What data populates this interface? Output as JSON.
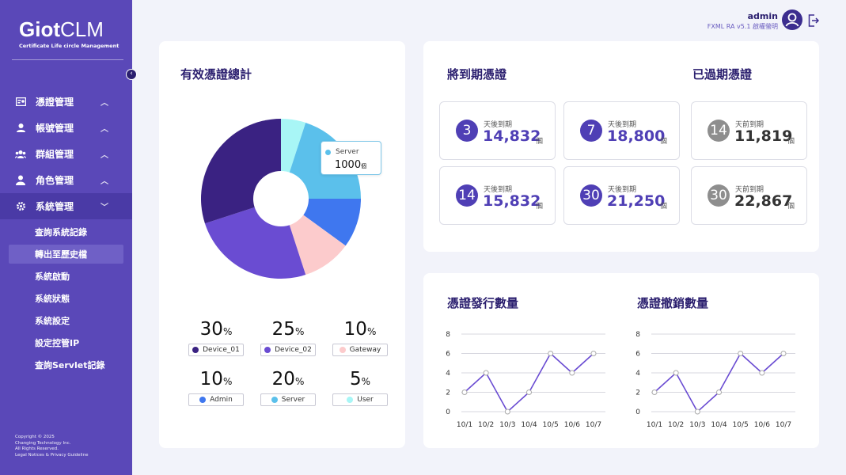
{
  "sidebar": {
    "logo_main": "Giot",
    "logo_clm": "CLM",
    "logo_sub": "Certificate Life circle Management",
    "menu": [
      {
        "label": "憑證管理",
        "icon": "certificate-icon",
        "caret": "^"
      },
      {
        "label": "帳號管理",
        "icon": "account-icon",
        "caret": "^"
      },
      {
        "label": "群組管理",
        "icon": "group-icon",
        "caret": "^"
      },
      {
        "label": "角色管理",
        "icon": "role-icon",
        "caret": "^"
      },
      {
        "label": "系統管理",
        "icon": "gear-icon",
        "caret": "v"
      }
    ],
    "submenu": [
      "查詢系統記錄",
      "轉出至歷史檔",
      "系統啟動",
      "系統狀態",
      "系統設定",
      "設定控管IP",
      "查詢Servlet記錄"
    ],
    "copyright": [
      "Copyright © 2025",
      "Changing Technology Inc.",
      "All Rights Reserved.",
      "Legal Notices & Privacy Guideline"
    ]
  },
  "header": {
    "user": "admin",
    "version": "FXML RA v5.1 啟權螢明"
  },
  "valid_cert": {
    "title": "有效憑證總計",
    "tooltip_label": "Server",
    "tooltip_value": "1000",
    "tooltip_unit": "個",
    "stats": [
      {
        "pct": "30",
        "unit": "%",
        "label": "Device_01",
        "color": "#3a2282"
      },
      {
        "pct": "25",
        "unit": "%",
        "label": "Device_02",
        "color": "#6a4cd2"
      },
      {
        "pct": "10",
        "unit": "%",
        "label": "Gateway",
        "color": "#fccbcc"
      },
      {
        "pct": "10",
        "unit": "%",
        "label": "Admin",
        "color": "#3f77ef"
      },
      {
        "pct": "20",
        "unit": "%",
        "label": "Server",
        "color": "#5bc0eb"
      },
      {
        "pct": "5",
        "unit": "%",
        "label": "User",
        "color": "#a8f6f6"
      }
    ]
  },
  "expiring": {
    "title": "將到期憑證",
    "items": [
      {
        "days": "3",
        "label": "天後到期",
        "value": "14,832",
        "unit": "個"
      },
      {
        "days": "7",
        "label": "天後到期",
        "value": "18,800",
        "unit": "個"
      },
      {
        "days": "14",
        "label": "天後到期",
        "value": "15,832",
        "unit": "個"
      },
      {
        "days": "30",
        "label": "天後到期",
        "value": "21,250",
        "unit": "個"
      }
    ]
  },
  "expired": {
    "title": "已過期憑證",
    "items": [
      {
        "days": "14",
        "label": "天前到期",
        "value": "11,819",
        "unit": "個"
      },
      {
        "days": "30",
        "label": "天前到期",
        "value": "22,867",
        "unit": "個"
      }
    ]
  },
  "chart_data": [
    {
      "type": "pie",
      "categories": [
        "Device_01",
        "Device_02",
        "Gateway",
        "Admin",
        "Server",
        "User"
      ],
      "values": [
        30,
        25,
        10,
        10,
        20,
        5
      ],
      "colors": [
        "#3a2282",
        "#6a4cd2",
        "#fccbcc",
        "#3f77ef",
        "#5bc0eb",
        "#a8f6f6"
      ]
    },
    {
      "type": "line",
      "title": "憑證發行數量",
      "categories": [
        "10/1",
        "10/2",
        "10/3",
        "10/4",
        "10/5",
        "10/6",
        "10/7"
      ],
      "values": [
        2,
        4,
        0,
        2,
        6,
        4,
        6
      ],
      "ylim": [
        0,
        8
      ],
      "yticks": [
        "0",
        "2",
        "4",
        "6",
        "8"
      ],
      "color": "#6a4cd2"
    },
    {
      "type": "line",
      "title": "憑證撤銷數量",
      "categories": [
        "10/1",
        "10/2",
        "10/3",
        "10/4",
        "10/5",
        "10/6",
        "10/7"
      ],
      "values": [
        2,
        4,
        0,
        2,
        6,
        4,
        6
      ],
      "ylim": [
        0,
        8
      ],
      "yticks": [
        "0",
        "2",
        "4",
        "6",
        "8"
      ],
      "color": "#6a4cd2"
    }
  ]
}
